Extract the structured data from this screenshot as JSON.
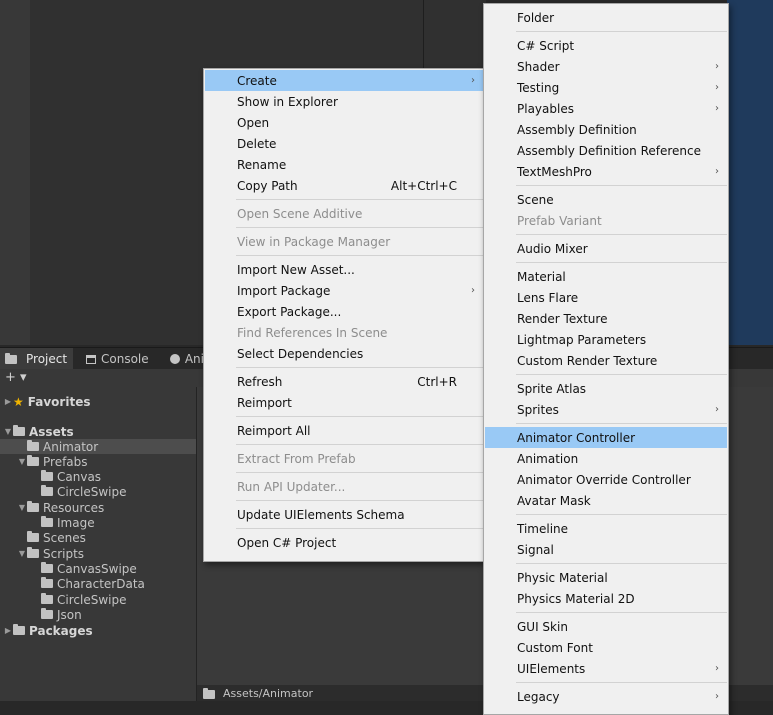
{
  "tabs": [
    {
      "label": "Project",
      "icon": "folder-icon"
    },
    {
      "label": "Console",
      "icon": "console-icon"
    },
    {
      "label": "Ani",
      "icon": "animation-icon"
    }
  ],
  "toolbar": {
    "add_label": "+ ▾"
  },
  "tree": [
    {
      "label": "Favorites",
      "indent": 0,
      "arrow": "▶",
      "icon": "star-icon",
      "bold": true
    },
    {
      "label": "Assets",
      "indent": 0,
      "arrow": "▼",
      "icon": "folder-open-icon",
      "bold": true
    },
    {
      "label": "Animator",
      "indent": 1,
      "arrow": "",
      "icon": "folder-icon",
      "selected": true
    },
    {
      "label": "Prefabs",
      "indent": 1,
      "arrow": "▼",
      "icon": "folder-open-icon"
    },
    {
      "label": "Canvas",
      "indent": 2,
      "arrow": "",
      "icon": "folder-icon"
    },
    {
      "label": "CircleSwipe",
      "indent": 2,
      "arrow": "",
      "icon": "folder-icon"
    },
    {
      "label": "Resources",
      "indent": 1,
      "arrow": "▼",
      "icon": "folder-open-icon"
    },
    {
      "label": "Image",
      "indent": 2,
      "arrow": "",
      "icon": "folder-icon"
    },
    {
      "label": "Scenes",
      "indent": 1,
      "arrow": "",
      "icon": "folder-icon"
    },
    {
      "label": "Scripts",
      "indent": 1,
      "arrow": "▼",
      "icon": "folder-open-icon"
    },
    {
      "label": "CanvasSwipe",
      "indent": 2,
      "arrow": "",
      "icon": "folder-icon"
    },
    {
      "label": "CharacterData",
      "indent": 2,
      "arrow": "",
      "icon": "folder-icon"
    },
    {
      "label": "CircleSwipe",
      "indent": 2,
      "arrow": "",
      "icon": "folder-icon"
    },
    {
      "label": "Json",
      "indent": 2,
      "arrow": "",
      "icon": "folder-icon"
    },
    {
      "label": "Packages",
      "indent": 0,
      "arrow": "▶",
      "icon": "folder-icon",
      "bold": true
    }
  ],
  "status_path": "Assets/Animator",
  "context_menu": [
    {
      "label": "Create",
      "submenu": true,
      "highlighted": true
    },
    {
      "label": "Show in Explorer"
    },
    {
      "label": "Open"
    },
    {
      "label": "Delete"
    },
    {
      "label": "Rename"
    },
    {
      "label": "Copy Path",
      "shortcut": "Alt+Ctrl+C"
    },
    {
      "sep": true
    },
    {
      "label": "Open Scene Additive",
      "disabled": true
    },
    {
      "sep": true
    },
    {
      "label": "View in Package Manager",
      "disabled": true
    },
    {
      "sep": true
    },
    {
      "label": "Import New Asset..."
    },
    {
      "label": "Import Package",
      "submenu": true
    },
    {
      "label": "Export Package..."
    },
    {
      "label": "Find References In Scene",
      "disabled": true
    },
    {
      "label": "Select Dependencies"
    },
    {
      "sep": true
    },
    {
      "label": "Refresh",
      "shortcut": "Ctrl+R"
    },
    {
      "label": "Reimport"
    },
    {
      "sep": true
    },
    {
      "label": "Reimport All"
    },
    {
      "sep": true
    },
    {
      "label": "Extract From Prefab",
      "disabled": true
    },
    {
      "sep": true
    },
    {
      "label": "Run API Updater...",
      "disabled": true
    },
    {
      "sep": true
    },
    {
      "label": "Update UIElements Schema"
    },
    {
      "sep": true
    },
    {
      "label": "Open C# Project"
    }
  ],
  "create_menu": [
    {
      "label": "Folder"
    },
    {
      "sep": true
    },
    {
      "label": "C# Script"
    },
    {
      "label": "Shader",
      "submenu": true
    },
    {
      "label": "Testing",
      "submenu": true
    },
    {
      "label": "Playables",
      "submenu": true
    },
    {
      "label": "Assembly Definition"
    },
    {
      "label": "Assembly Definition Reference"
    },
    {
      "label": "TextMeshPro",
      "submenu": true
    },
    {
      "sep": true
    },
    {
      "label": "Scene"
    },
    {
      "label": "Prefab Variant",
      "disabled": true
    },
    {
      "sep": true
    },
    {
      "label": "Audio Mixer"
    },
    {
      "sep": true
    },
    {
      "label": "Material"
    },
    {
      "label": "Lens Flare"
    },
    {
      "label": "Render Texture"
    },
    {
      "label": "Lightmap Parameters"
    },
    {
      "label": "Custom Render Texture"
    },
    {
      "sep": true
    },
    {
      "label": "Sprite Atlas"
    },
    {
      "label": "Sprites",
      "submenu": true
    },
    {
      "sep": true
    },
    {
      "label": "Animator Controller",
      "highlighted": true
    },
    {
      "label": "Animation"
    },
    {
      "label": "Animator Override Controller"
    },
    {
      "label": "Avatar Mask"
    },
    {
      "sep": true
    },
    {
      "label": "Timeline"
    },
    {
      "label": "Signal"
    },
    {
      "sep": true
    },
    {
      "label": "Physic Material"
    },
    {
      "label": "Physics Material 2D"
    },
    {
      "sep": true
    },
    {
      "label": "GUI Skin"
    },
    {
      "label": "Custom Font"
    },
    {
      "label": "UIElements",
      "submenu": true
    },
    {
      "sep": true
    },
    {
      "label": "Legacy",
      "submenu": true
    }
  ],
  "colors": {
    "menu_bg": "#f0f0f0",
    "highlight": "#99c9f5",
    "disabled": "#8d8d8d",
    "panel": "#383838"
  }
}
